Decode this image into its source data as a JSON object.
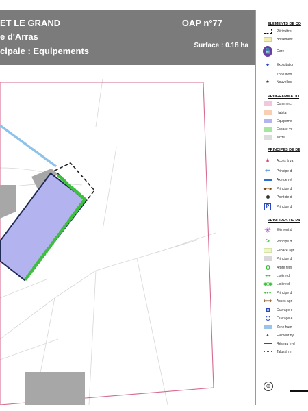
{
  "header": {
    "line1": "ET LE GRAND",
    "line2": "e d'Arras",
    "line3": "cipale : Equipements",
    "oap": "OAP n°77",
    "surface": "Surface : 0.18 ha"
  },
  "legend": {
    "sections": [
      {
        "title": "ELEMENTS DE CO",
        "items": [
          {
            "icon": "dashed-rectangle",
            "label": "Périmètre"
          },
          {
            "icon": "yellow-swatch",
            "label": "Boisement"
          },
          {
            "icon": "train-station",
            "label": "Gare"
          },
          {
            "icon": "blue-star",
            "label": "Exploitation"
          },
          {
            "icon": "none",
            "label": "Zone inon"
          },
          {
            "icon": "black-star",
            "label": "Nouvelles"
          }
        ]
      },
      {
        "title": "PROGRAMMATIO",
        "items": [
          {
            "icon": "pink-swatch",
            "label": "Commerci"
          },
          {
            "icon": "orange-swatch",
            "label": "Habitat"
          },
          {
            "icon": "purple-swatch",
            "label": "Equipeme"
          },
          {
            "icon": "green-swatch",
            "label": "Espace ve"
          },
          {
            "icon": "grey-swatch",
            "label": "Mixte"
          }
        ]
      },
      {
        "title": "PRINCIPES DE DE",
        "items": [
          {
            "icon": "pink-star",
            "label": "Accès à va"
          },
          {
            "icon": "blue-arrow",
            "label": "Principe d"
          },
          {
            "icon": "dashed-blue-line",
            "label": "Axe de rel"
          },
          {
            "icon": "double-arrow",
            "label": "Principe d"
          },
          {
            "icon": "point",
            "label": "Point de d"
          },
          {
            "icon": "parking",
            "label": "Principe d"
          }
        ]
      },
      {
        "title": "PRINCIPES DE PA",
        "items": [
          {
            "icon": "purple-asterisk",
            "label": "Elément d"
          },
          {
            "icon": "green-chevron",
            "label": "Principe d"
          },
          {
            "icon": "pale-green-swatch",
            "label": "Espace agri"
          },
          {
            "icon": "light-grey-swatch",
            "label": "Principe d"
          },
          {
            "icon": "green-ring",
            "label": "Arbre rem"
          },
          {
            "icon": "green-dots-small",
            "label": "Lisière d"
          },
          {
            "icon": "green-rings-large",
            "label": "Lisière d"
          },
          {
            "icon": "green-dots",
            "label": "Principe d"
          },
          {
            "icon": "brown-double-arrow",
            "label": "Accès agri"
          },
          {
            "icon": "blue-circle",
            "label": "Ouvrage e"
          },
          {
            "icon": "blue-ring",
            "label": "Ouvrage e"
          },
          {
            "icon": "blue-swatch",
            "label": "Zone hum"
          },
          {
            "icon": "blue-triangle",
            "label": "Elément hy"
          },
          {
            "icon": "blue-line",
            "label": "Réseau hyd"
          },
          {
            "icon": "dotted-line",
            "label": "Talus à m"
          }
        ]
      }
    ]
  },
  "colors": {
    "header_bg": "#7b7b7b",
    "equipment": "#b3b3ef",
    "perimeter": "#d66a8f",
    "hedge": "#3fbf3f",
    "building": "#a7a7a7",
    "path": "#8fc2e8"
  }
}
